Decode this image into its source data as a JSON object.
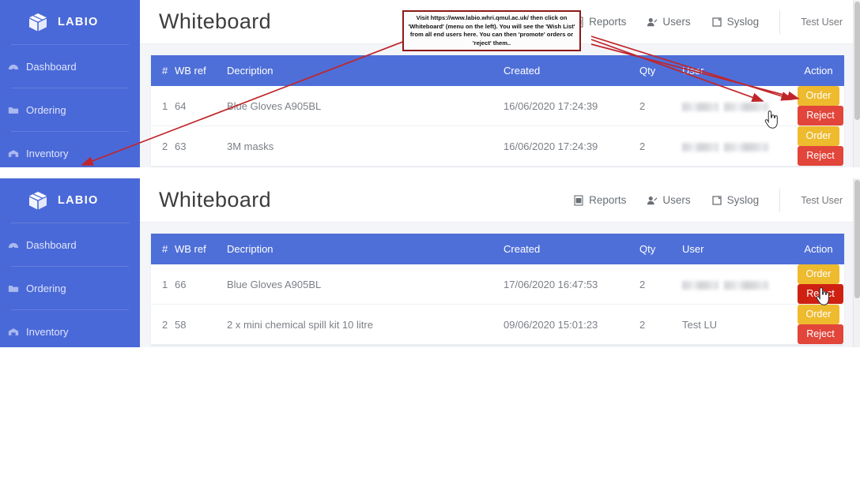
{
  "app": {
    "brand": "LABIO",
    "brand_icon": "cube-box-icon",
    "page_title": "Whiteboard"
  },
  "sidebar": {
    "items": [
      {
        "label": "Dashboard",
        "icon": "dashboard-gauge-icon"
      },
      {
        "label": "Ordering",
        "icon": "folder-icon"
      },
      {
        "label": "Inventory",
        "icon": "warehouse-icon"
      }
    ]
  },
  "topnav": {
    "items": [
      {
        "label": "Reports",
        "icon": "spreadsheet-icon"
      },
      {
        "label": "Users",
        "icon": "user-edit-icon"
      },
      {
        "label": "Syslog",
        "icon": "document-icon"
      }
    ],
    "user": "Test User"
  },
  "table": {
    "columns": [
      "#",
      "WB ref",
      "Decription",
      "Created",
      "Qty",
      "User",
      "Action"
    ],
    "actions": {
      "order": "Order",
      "reject": "Reject"
    }
  },
  "panel_1": {
    "rows": [
      {
        "num": "1",
        "ref": "64",
        "desc": "Blue Gloves A905BL",
        "created": "16/06/2020 17:24:39",
        "qty": "2",
        "user": "",
        "user_blurred": true
      },
      {
        "num": "2",
        "ref": "63",
        "desc": "3M masks",
        "created": "16/06/2020 17:24:39",
        "qty": "2",
        "user": "",
        "user_blurred": true
      }
    ]
  },
  "panel_2": {
    "rows": [
      {
        "num": "1",
        "ref": "66",
        "desc": "Blue Gloves A905BL",
        "created": "17/06/2020 16:47:53",
        "qty": "2",
        "user": "",
        "user_blurred": true
      },
      {
        "num": "2",
        "ref": "58",
        "desc": "2 x mini chemical spill kit 10 litre",
        "created": "09/06/2020 15:01:23",
        "qty": "2",
        "user": "Test LU",
        "user_blurred": false
      }
    ]
  },
  "annotation": {
    "text": "Visit https://www.labio.whri.qmul.ac.uk/ then click on 'Whiteboard' (menu on the left). You will see the 'Wish List' from all end users here. You can then 'promote' orders or 'reject' them..",
    "color": "#8d1a17",
    "arrow_color": "#c0252a"
  },
  "colors": {
    "sidebar": "#4a69d8",
    "table_header": "#4e6fd8",
    "order_button": "#eeba2e",
    "reject_button": "#e2453a",
    "reject_button_active": "#cf2112"
  }
}
